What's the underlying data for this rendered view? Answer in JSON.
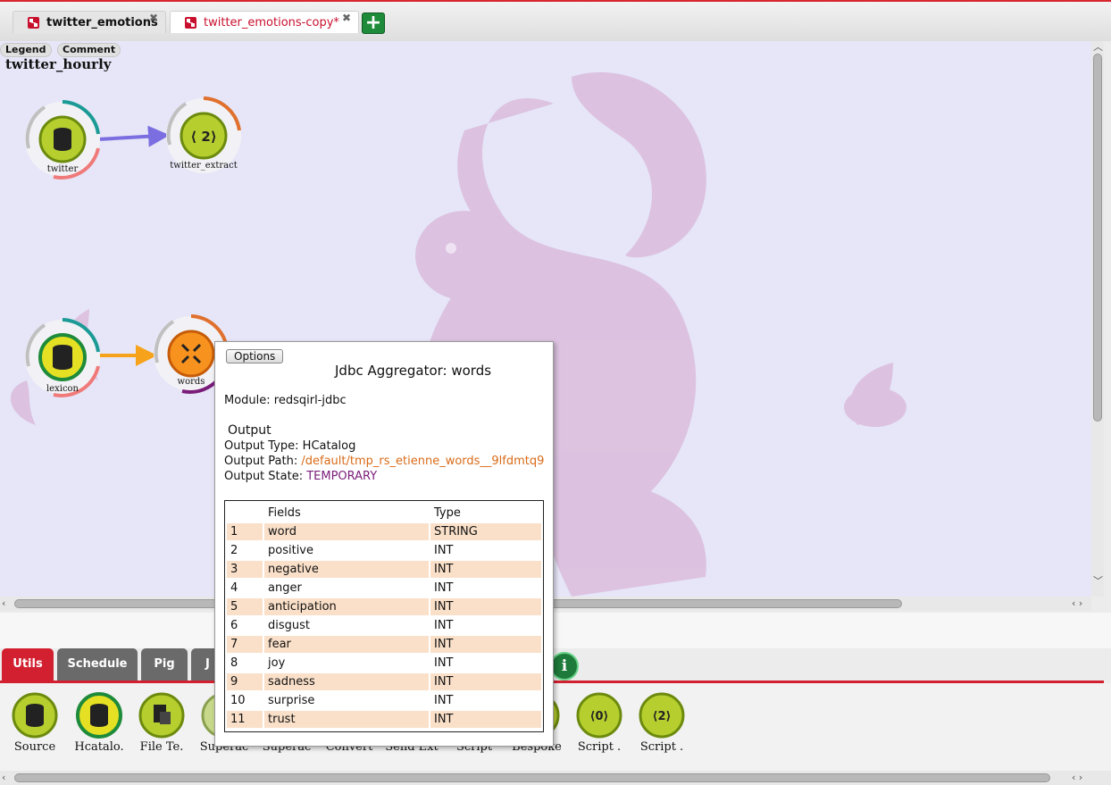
{
  "tabs": [
    {
      "label": "twitter_emotions",
      "active": false
    },
    {
      "label": "twitter_emotions-copy*",
      "active": true
    }
  ],
  "canvas": {
    "legend_label": "Legend",
    "comment_label": "Comment",
    "title": "twitter_hourly",
    "nodes": [
      {
        "label": "twitter"
      },
      {
        "label": "twitter_extract"
      },
      {
        "label": "lexicon"
      },
      {
        "label": "words"
      }
    ]
  },
  "palette_tabs": [
    "Utils",
    "Schedule",
    "Pig",
    "J"
  ],
  "palette_items": [
    {
      "label": "Source",
      "icon": "database-icon"
    },
    {
      "label": "Hcatalo.",
      "icon": "database-icon"
    },
    {
      "label": "File Te.",
      "icon": "file-icon"
    },
    {
      "label": "Superac",
      "icon": "superaction-icon"
    },
    {
      "label": "Superac",
      "icon": "superaction-icon"
    },
    {
      "label": "Convert",
      "icon": "convert-icon"
    },
    {
      "label": "Send Ext",
      "icon": "send-icon"
    },
    {
      "label": "Script",
      "icon": "script-icon"
    },
    {
      "label": "Bespoke",
      "icon": "bespoke-icon"
    },
    {
      "label": "Script .",
      "icon": "script-0-icon"
    },
    {
      "label": "Script .",
      "icon": "script-2-icon"
    }
  ],
  "popup": {
    "options_label": "Options",
    "title": "Jdbc Aggregator: words",
    "module": "Module: redsqirl-jdbc",
    "output_heading": "Output",
    "output_type_label": "Output Type: ",
    "output_type": "HCatalog",
    "output_path_label": "Output Path: ",
    "output_path": "/default/tmp_rs_etienne_words__9lfdmtq9",
    "output_state_label": "Output State: ",
    "output_state": "TEMPORARY",
    "table_headers": [
      "Fields",
      "Type"
    ],
    "rows": [
      {
        "n": "1",
        "field": "word",
        "type": "STRING"
      },
      {
        "n": "2",
        "field": "positive",
        "type": "INT"
      },
      {
        "n": "3",
        "field": "negative",
        "type": "INT"
      },
      {
        "n": "4",
        "field": "anger",
        "type": "INT"
      },
      {
        "n": "5",
        "field": "anticipation",
        "type": "INT"
      },
      {
        "n": "6",
        "field": "disgust",
        "type": "INT"
      },
      {
        "n": "7",
        "field": "fear",
        "type": "INT"
      },
      {
        "n": "8",
        "field": "joy",
        "type": "INT"
      },
      {
        "n": "9",
        "field": "sadness",
        "type": "INT"
      },
      {
        "n": "10",
        "field": "surprise",
        "type": "INT"
      },
      {
        "n": "11",
        "field": "trust",
        "type": "INT"
      }
    ]
  },
  "info_button": "i",
  "colors": {
    "accent": "#d32030",
    "canvas": "#e6e6f8",
    "orange": "#d96b19",
    "purple": "#7a1d7a"
  }
}
